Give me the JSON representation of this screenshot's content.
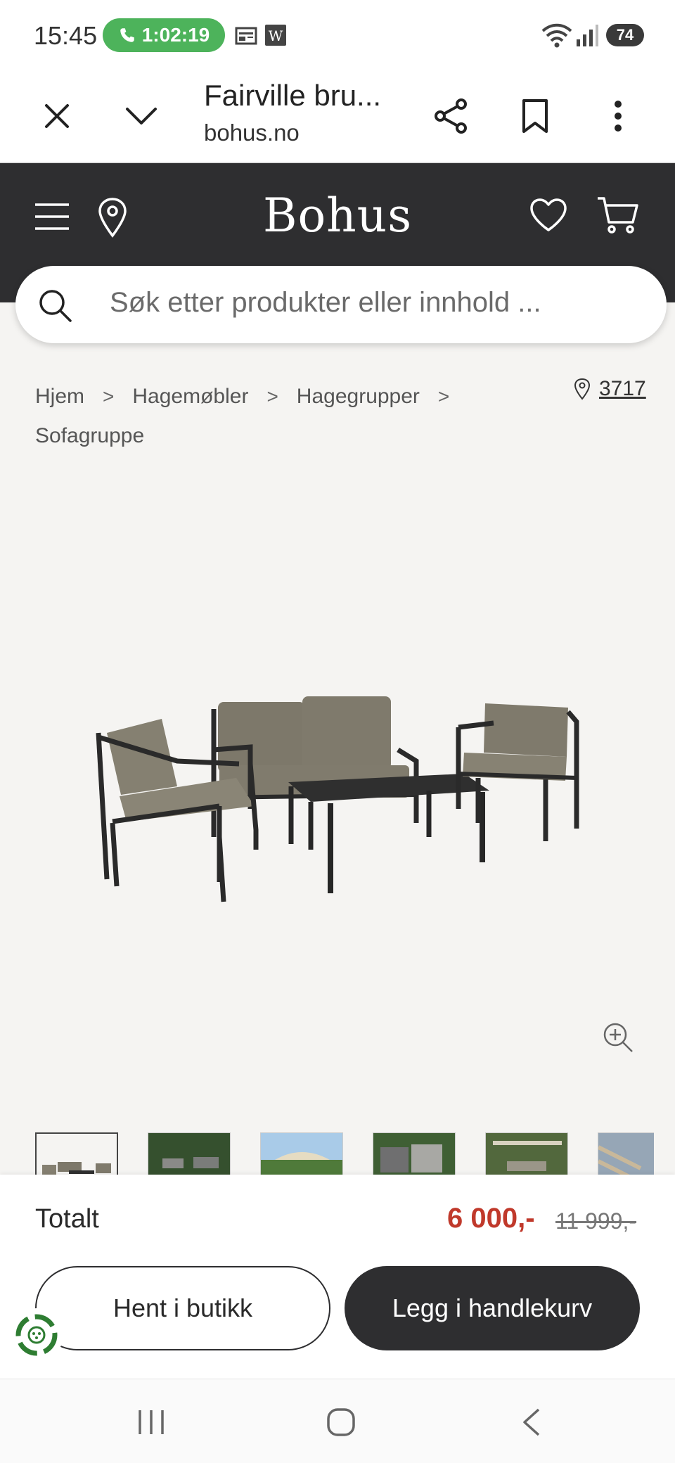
{
  "status_bar": {
    "time": "15:45",
    "call_timer": "1:02:19",
    "battery": "74",
    "icons": [
      "phone-bluetooth-icon",
      "news-icon",
      "w-app-icon",
      "wifi-icon",
      "signal-icon",
      "battery-icon"
    ]
  },
  "browser": {
    "page_title": "Fairville bru...",
    "url": "bohus.no",
    "icons": [
      "close-icon",
      "chevron-down-icon",
      "share-icon",
      "bookmark-icon",
      "more-icon"
    ]
  },
  "header": {
    "logo": "Bohus",
    "search_placeholder": "Søk etter produkter eller innhold ...",
    "icons": [
      "menu-icon",
      "location-pin-icon",
      "heart-icon",
      "cart-icon",
      "search-icon"
    ]
  },
  "breadcrumb": {
    "items": [
      "Hjem",
      "Hagemøbler",
      "Hagegrupper",
      "Sofagruppe"
    ],
    "store_number": "3717"
  },
  "product": {
    "image": "outdoor-sofa-group-image",
    "thumbnails_count": 6
  },
  "buybar": {
    "total_label": "Totalt",
    "price": "6 000,-",
    "old_price": "11 999,-",
    "pickup_button": "Hent i butikk",
    "cart_button": "Legg i handlekurv"
  },
  "colors": {
    "header_bg": "#2e2e30",
    "content_bg": "#f5f4f2",
    "price_red": "#c0392b",
    "call_green": "#4db35b"
  }
}
